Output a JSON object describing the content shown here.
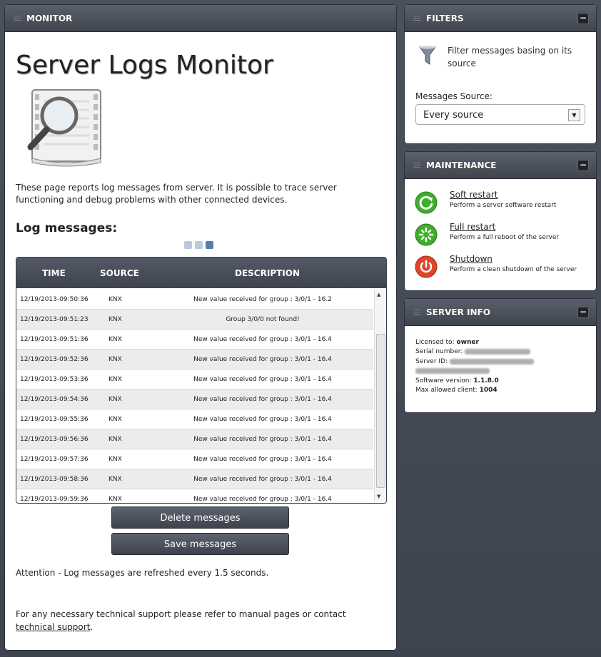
{
  "monitor": {
    "header": "MONITOR",
    "title": "Server Logs Monitor",
    "intro": "These page reports log messages from server. It is possible to trace server functioning and debug problems with other connected devices.",
    "section_title": "Log messages:",
    "table": {
      "columns": [
        "TIME",
        "SOURCE",
        "DESCRIPTION"
      ],
      "rows": [
        {
          "time": "12/19/2013-09:50:36",
          "source": "KNX",
          "description": "New value received for group : 3/0/1 - 16.2"
        },
        {
          "time": "12/19/2013-09:51:23",
          "source": "KNX",
          "description": "Group 3/0/0 not found!"
        },
        {
          "time": "12/19/2013-09:51:36",
          "source": "KNX",
          "description": "New value received for group : 3/0/1 - 16.4"
        },
        {
          "time": "12/19/2013-09:52:36",
          "source": "KNX",
          "description": "New value received for group : 3/0/1 - 16.4"
        },
        {
          "time": "12/19/2013-09:53:36",
          "source": "KNX",
          "description": "New value received for group : 3/0/1 - 16.4"
        },
        {
          "time": "12/19/2013-09:54:36",
          "source": "KNX",
          "description": "New value received for group : 3/0/1 - 16.4"
        },
        {
          "time": "12/19/2013-09:55:36",
          "source": "KNX",
          "description": "New value received for group : 3/0/1 - 16.4"
        },
        {
          "time": "12/19/2013-09:56:36",
          "source": "KNX",
          "description": "New value received for group : 3/0/1 - 16.4"
        },
        {
          "time": "12/19/2013-09:57:36",
          "source": "KNX",
          "description": "New value received for group : 3/0/1 - 16.4"
        },
        {
          "time": "12/19/2013-09:58:36",
          "source": "KNX",
          "description": "New value received for group : 3/0/1 - 16.4"
        },
        {
          "time": "12/19/2013-09:59:36",
          "source": "KNX",
          "description": "New value received for group : 3/0/1 - 16.4"
        }
      ]
    },
    "delete_button": "Delete messages",
    "save_button": "Save messages",
    "attention": "Attention - Log messages are refreshed every 1.5 seconds.",
    "support_text": "For any necessary technical support please refer to manual pages or contact ",
    "support_link": "technical support",
    "support_end": "."
  },
  "filters": {
    "header": "FILTERS",
    "collapse": "−",
    "description": "Filter messages basing on its source",
    "label": "Messages Source:",
    "selected": "Every source"
  },
  "maintenance": {
    "header": "MAINTENANCE",
    "collapse": "−",
    "items": [
      {
        "title": "Soft restart",
        "desc": "Perform a server software restart",
        "color": "#3fae2a"
      },
      {
        "title": "Full restart",
        "desc": "Perform a full reboot of the server",
        "color": "#3fae2a"
      },
      {
        "title": "Shutdown",
        "desc": "Perform a clean shutdown of the server",
        "color": "#e0452a"
      }
    ]
  },
  "server_info": {
    "header": "SERVER INFO",
    "collapse": "−",
    "licensed_label": "Licensed to:",
    "licensed_value": "owner",
    "serial_label": "Serial number:",
    "server_id_label": "Server ID:",
    "software_label": "Software version:",
    "software_value": "1.1.8.0",
    "max_clients_label": "Max allowed client:",
    "max_clients_value": "1004"
  }
}
